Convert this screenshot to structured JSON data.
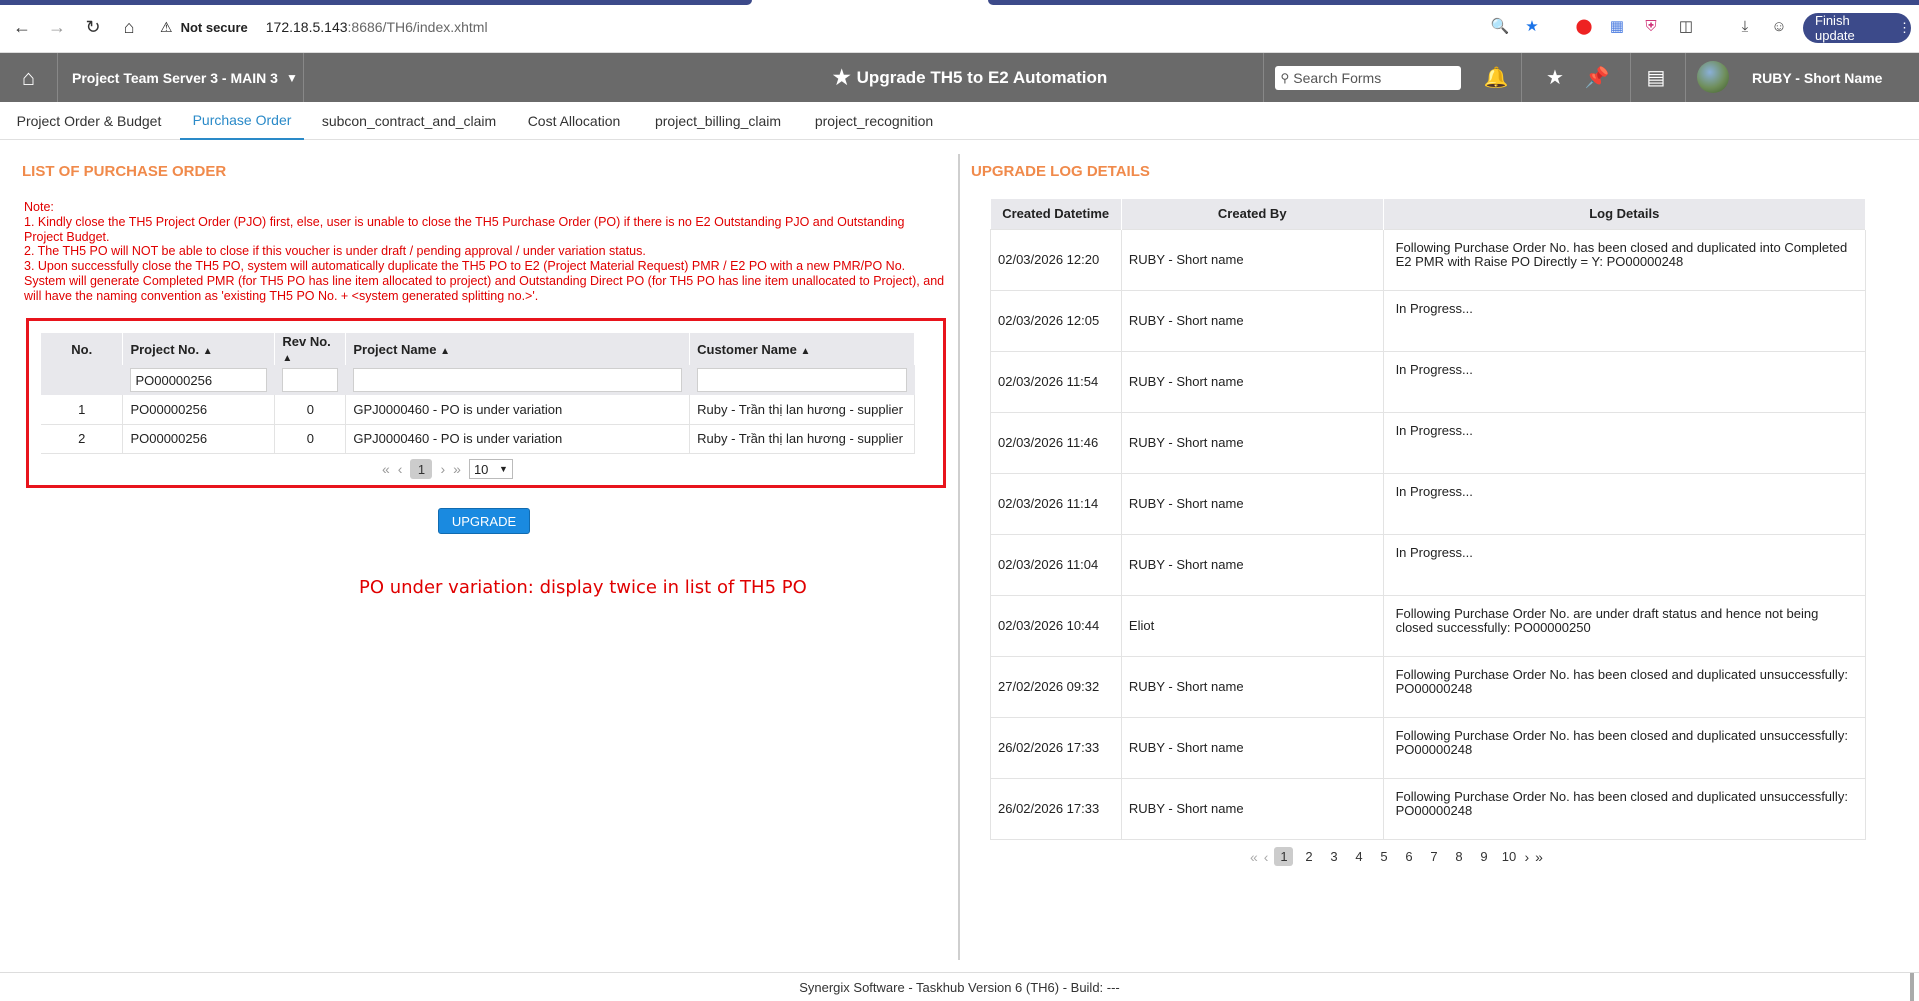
{
  "browser": {
    "security_label": "Not secure",
    "url_host": "172.18.5.143",
    "url_path": ":8686/TH6/index.xhtml",
    "finish_update_label": "Finish update"
  },
  "header": {
    "server_label": "Project Team Server 3 - MAIN 3",
    "title": "Upgrade TH5 to E2 Automation",
    "search_placeholder": "Search Forms",
    "user_name": "RUBY - Short Name"
  },
  "tabs": [
    {
      "label": "Project Order & Budget"
    },
    {
      "label": "Purchase Order"
    },
    {
      "label": "subcon_contract_and_claim"
    },
    {
      "label": "Cost Allocation"
    },
    {
      "label": "project_billing_claim"
    },
    {
      "label": "project_recognition"
    }
  ],
  "left": {
    "title": "LIST OF PURCHASE ORDER",
    "note_lines": [
      "Note:",
      "1. Kindly close the TH5 Project Order (PJO) first, else, user is unable to close the TH5 Purchase Order (PO) if there is no E2 Outstanding PJO and Outstanding Project Budget.",
      "2. The TH5 PO will NOT be able to close if this voucher is under draft / pending approval / under variation status.",
      "3. Upon successfully close the TH5 PO, system will automatically duplicate the TH5 PO to E2 (Project Material Request) PMR / E2 PO with a new PMR/PO No. System will generate Completed PMR (for TH5 PO has line item allocated to project) and Outstanding Direct PO (for TH5 PO has line item unallocated to Project), and will have the naming convention as 'existing TH5 PO No. + <system generated splitting no.>'."
    ],
    "table": {
      "headers": [
        "No.",
        "Project No.",
        "Rev No.",
        "Project Name",
        "Customer Name"
      ],
      "filter_project_no": "PO00000256",
      "rows": [
        {
          "no": "1",
          "project_no": "PO00000256",
          "rev": "0",
          "project_name": "GPJ0000460 - PO is under variation",
          "customer": "Ruby - Trần thị lan hương - supplier"
        },
        {
          "no": "2",
          "project_no": "PO00000256",
          "rev": "0",
          "project_name": "GPJ0000460 - PO is under variation",
          "customer": "Ruby - Trần thị lan hương - supplier"
        }
      ],
      "current_page": "1",
      "rows_per_page": "10"
    },
    "upgrade_label": "UPGRADE",
    "annotation": "PO under variation: display twice in list of TH5 PO"
  },
  "right": {
    "title": "UPGRADE LOG DETAILS",
    "headers": [
      "Created Datetime",
      "Created By",
      "Log Details"
    ],
    "rows": [
      {
        "datetime": "02/03/2026 12:20",
        "by": "RUBY - Short name",
        "details": "Following Purchase Order No. has been closed and duplicated into Completed E2 PMR with Raise PO Directly = Y: PO00000248"
      },
      {
        "datetime": "02/03/2026 12:05",
        "by": "RUBY - Short name",
        "details": "In Progress..."
      },
      {
        "datetime": "02/03/2026 11:54",
        "by": "RUBY - Short name",
        "details": "In Progress..."
      },
      {
        "datetime": "02/03/2026 11:46",
        "by": "RUBY - Short name",
        "details": "In Progress..."
      },
      {
        "datetime": "02/03/2026 11:14",
        "by": "RUBY - Short name",
        "details": "In Progress..."
      },
      {
        "datetime": "02/03/2026 11:04",
        "by": "RUBY - Short name",
        "details": "In Progress..."
      },
      {
        "datetime": "02/03/2026 10:44",
        "by": "Eliot",
        "details": "Following Purchase Order No. are under draft status and hence not being closed successfully: PO00000250"
      },
      {
        "datetime": "27/02/2026 09:32",
        "by": "RUBY - Short name",
        "details": "Following Purchase Order No. has been closed and duplicated unsuccessfully: PO00000248"
      },
      {
        "datetime": "26/02/2026 17:33",
        "by": "RUBY - Short name",
        "details": "Following Purchase Order No. has been closed and duplicated unsuccessfully: PO00000248"
      },
      {
        "datetime": "26/02/2026 17:33",
        "by": "RUBY - Short name",
        "details": "Following Purchase Order No. has been closed and duplicated unsuccessfully: PO00000248"
      }
    ],
    "pages": [
      "1",
      "2",
      "3",
      "4",
      "5",
      "6",
      "7",
      "8",
      "9",
      "10"
    ],
    "current_page": "1"
  },
  "footer": "Synergix Software - Taskhub Version 6 (TH6) - Build: ---"
}
